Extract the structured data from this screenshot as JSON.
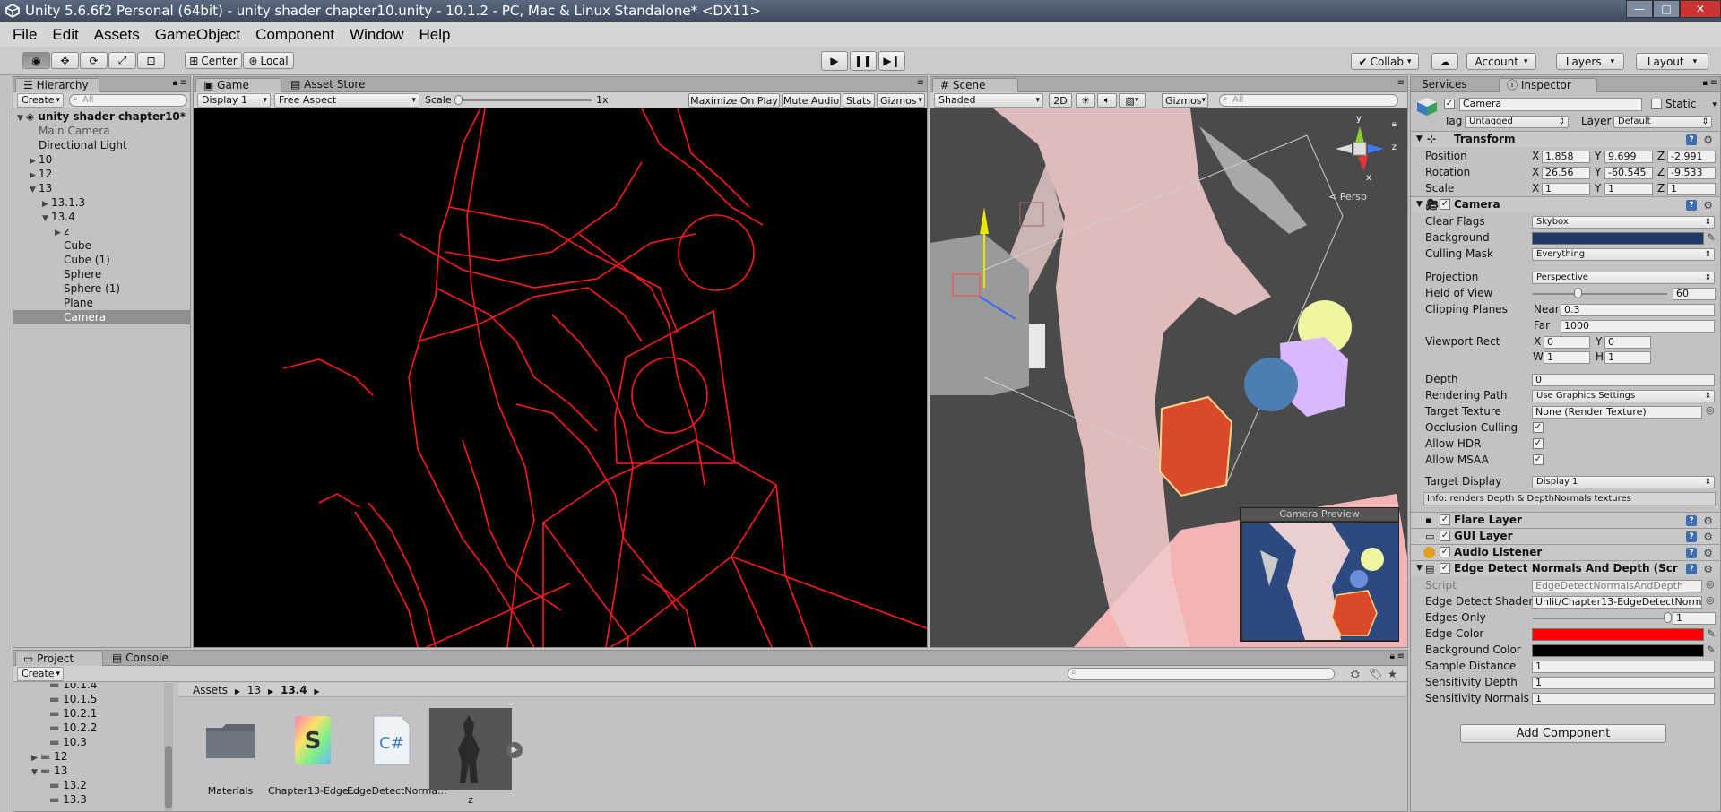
{
  "titlebar": {
    "title": "Unity 5.6.6f2 Personal (64bit) - unity shader chapter10.unity - 10.1.2 - PC, Mac & Linux Standalone* <DX11>"
  },
  "menu": [
    "File",
    "Edit",
    "Assets",
    "GameObject",
    "Component",
    "Window",
    "Help"
  ],
  "toolbar": {
    "pivot": "Center",
    "space": "Local",
    "collab": "Collab",
    "account": "Account",
    "layers": "Layers",
    "layout": "Layout"
  },
  "hierarchy": {
    "tab": "Hierarchy",
    "create": "Create",
    "search_placeholder": "All",
    "items": [
      {
        "label": "unity shader chapter10*",
        "depth": 0,
        "arrow": "▼",
        "bold": true
      },
      {
        "label": "Main Camera",
        "depth": 1,
        "arrow": "",
        "dim": true
      },
      {
        "label": "Directional Light",
        "depth": 1,
        "arrow": ""
      },
      {
        "label": "10",
        "depth": 1,
        "arrow": "▶"
      },
      {
        "label": "12",
        "depth": 1,
        "arrow": "▶"
      },
      {
        "label": "13",
        "depth": 1,
        "arrow": "▼"
      },
      {
        "label": "13.1.3",
        "depth": 2,
        "arrow": "▶"
      },
      {
        "label": "13.4",
        "depth": 2,
        "arrow": "▼"
      },
      {
        "label": "z",
        "depth": 3,
        "arrow": "▶"
      },
      {
        "label": "Cube",
        "depth": 3,
        "arrow": ""
      },
      {
        "label": "Cube (1)",
        "depth": 3,
        "arrow": ""
      },
      {
        "label": "Sphere",
        "depth": 3,
        "arrow": ""
      },
      {
        "label": "Sphere (1)",
        "depth": 3,
        "arrow": ""
      },
      {
        "label": "Plane",
        "depth": 3,
        "arrow": ""
      },
      {
        "label": "Camera",
        "depth": 3,
        "arrow": "",
        "selected": true
      }
    ]
  },
  "game": {
    "tabs": [
      "Game",
      "Asset Store"
    ],
    "display": "Display 1",
    "aspect": "Free Aspect",
    "scale_label": "Scale",
    "scale_value": "1x",
    "options": [
      "Maximize On Play",
      "Mute Audio",
      "Stats",
      "Gizmos"
    ]
  },
  "scene": {
    "tab": "Scene",
    "shading": "Shaded",
    "mode2d": "2D",
    "gizmos": "Gizmos",
    "search_placeholder": "All",
    "persp": "< Persp",
    "axis_y": "y",
    "axis_z": "z",
    "axis_x": "x",
    "preview_title": "Camera Preview"
  },
  "inspector": {
    "tabs": [
      "Services",
      "Inspector"
    ],
    "name": "Camera",
    "static": "Static",
    "tag_label": "Tag",
    "tag": "Untagged",
    "layer_label": "Layer",
    "layer": "Default",
    "transform": {
      "title": "Transform",
      "rows": [
        {
          "label": "Position",
          "x": "1.858",
          "y": "9.699",
          "z": "-2.991"
        },
        {
          "label": "Rotation",
          "x": "26.56",
          "y": "-60.545",
          "z": "-9.533"
        },
        {
          "label": "Scale",
          "x": "1",
          "y": "1",
          "z": "1"
        }
      ]
    },
    "camera": {
      "title": "Camera",
      "clear_flags_label": "Clear Flags",
      "clear_flags": "Skybox",
      "background_label": "Background",
      "background_color": "#1f3a66",
      "culling_label": "Culling Mask",
      "culling": "Everything",
      "projection_label": "Projection",
      "projection": "Perspective",
      "fov_label": "Field of View",
      "fov": "60",
      "fov_fraction": 0.33,
      "clip_label": "Clipping Planes",
      "near_label": "Near",
      "near": "0.3",
      "far_label": "Far",
      "far": "1000",
      "viewport_label": "Viewport Rect",
      "vx": "0",
      "vy": "0",
      "vw": "1",
      "vh": "1",
      "depth_label": "Depth",
      "depth": "0",
      "rendering_label": "Rendering Path",
      "rendering": "Use Graphics Settings",
      "target_tex_label": "Target Texture",
      "target_tex": "None (Render Texture)",
      "occlusion_label": "Occlusion Culling",
      "hdr_label": "Allow HDR",
      "msaa_label": "Allow MSAA",
      "target_display_label": "Target Display",
      "target_display": "Display 1",
      "info": "Info: renders Depth & DepthNormals textures"
    },
    "components": [
      "Flare Layer",
      "GUI Layer",
      "Audio Listener"
    ],
    "edge": {
      "title": "Edge Detect Normals And Depth (Script)",
      "script_label": "Script",
      "script": "EdgeDetectNormalsAndDepth",
      "shader_label": "Edge Detect Shader",
      "shader": "Unlit/Chapter13-EdgeDetectNormals",
      "edges_only_label": "Edges Only",
      "edges_only": "1",
      "edges_only_fraction": 1,
      "edge_color_label": "Edge Color",
      "edge_color": "#ff0000",
      "bg_color_label": "Background Color",
      "bg_color": "#000000",
      "sample_label": "Sample Distance",
      "sample": "1",
      "sdepth_label": "Sensitivity Depth",
      "sdepth": "1",
      "snormals_label": "Sensitivity Normals",
      "snormals": "1"
    },
    "add_component": "Add Component"
  },
  "project": {
    "tabs": [
      "Project",
      "Console"
    ],
    "create": "Create",
    "tree": [
      {
        "label": "10.1.4",
        "depth": 2,
        "arrow": ""
      },
      {
        "label": "10.1.5",
        "depth": 2,
        "arrow": ""
      },
      {
        "label": "10.2.1",
        "depth": 2,
        "arrow": ""
      },
      {
        "label": "10.2.2",
        "depth": 2,
        "arrow": ""
      },
      {
        "label": "10.3",
        "depth": 2,
        "arrow": ""
      },
      {
        "label": "12",
        "depth": 1,
        "arrow": "▶"
      },
      {
        "label": "13",
        "depth": 1,
        "arrow": "▼"
      },
      {
        "label": "13.2",
        "depth": 2,
        "arrow": ""
      },
      {
        "label": "13.3",
        "depth": 2,
        "arrow": ""
      }
    ],
    "breadcrumb": [
      "Assets",
      "13",
      "13.4"
    ],
    "assets": [
      {
        "label": "Materials",
        "kind": "folder"
      },
      {
        "label": "Chapter13-Edge...",
        "kind": "shader"
      },
      {
        "label": "EdgeDetectNorma...",
        "kind": "script"
      },
      {
        "label": "z",
        "kind": "model"
      }
    ]
  }
}
